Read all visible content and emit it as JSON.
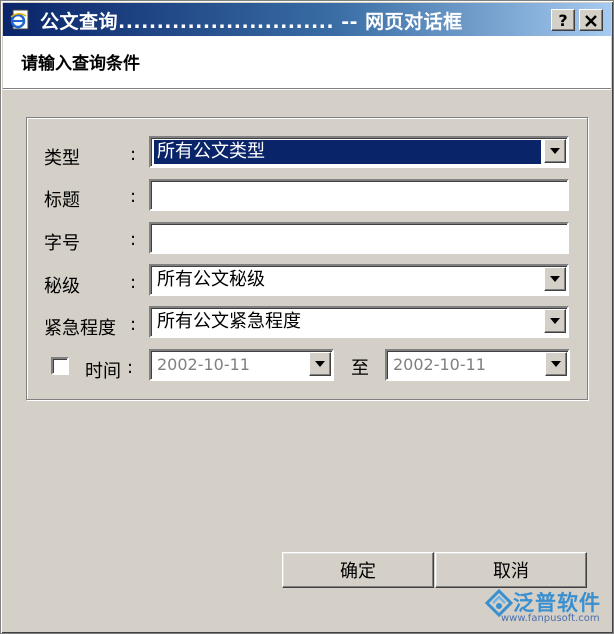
{
  "window": {
    "title": "公文查询............................ -- 网页对话框",
    "help_label": "?",
    "close_label": "X"
  },
  "header": {
    "title": "请输入查询条件"
  },
  "form": {
    "type": {
      "label": "类型",
      "colon": ":",
      "value": "所有公文类型"
    },
    "subject": {
      "label": "标题",
      "colon": ":",
      "value": ""
    },
    "doc_number": {
      "label": "字号",
      "colon": ":",
      "value": ""
    },
    "secrecy": {
      "label": "秘级",
      "colon": ":",
      "value": "所有公文秘级"
    },
    "urgency": {
      "label": "紧急程度",
      "colon": ":",
      "value": "所有公文紧急程度"
    },
    "time": {
      "label": "时间",
      "colon": ":",
      "checked": false,
      "from": "2002-10-11",
      "to_label": "至",
      "to": "2002-10-11"
    }
  },
  "buttons": {
    "ok": "确定",
    "cancel": "取消"
  },
  "watermark": {
    "brand": "泛普软件",
    "url": "www.fanpusoft.com"
  },
  "colors": {
    "title_bar": "#0a246a",
    "face": "#d4d0c8",
    "selection": "#0a246a",
    "watermark": "#3a8fcf"
  }
}
